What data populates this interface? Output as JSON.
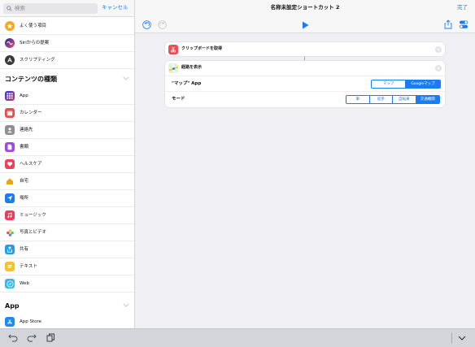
{
  "sidebar": {
    "search_placeholder": "検索",
    "cancel_label": "キャンセル",
    "top_items": [
      {
        "label": "よく使う項目",
        "icon": "star-icon",
        "color": "#f5a623"
      },
      {
        "label": "Siriからの提案",
        "icon": "siri-icon",
        "color": "#5b5fd6"
      },
      {
        "label": "スクリプティング",
        "icon": "scripting-icon",
        "color": "#3a3a3c"
      }
    ],
    "content_section_title": "コンテンツの種類",
    "content_items": [
      {
        "label": "App",
        "icon": "app-grid-icon",
        "color": "#5a3fd1"
      },
      {
        "label": "カレンダー",
        "icon": "calendar-icon",
        "color": "#ec4b4b"
      },
      {
        "label": "連絡先",
        "icon": "contacts-icon",
        "color": "#8e8e93"
      },
      {
        "label": "書類",
        "icon": "document-icon",
        "color": "#a347e0"
      },
      {
        "label": "ヘルスケア",
        "icon": "heart-icon",
        "color": "#ef3f5a"
      },
      {
        "label": "自宅",
        "icon": "home-icon",
        "color": "#f0a21a"
      },
      {
        "label": "場所",
        "icon": "location-icon",
        "color": "#1a7cf3"
      },
      {
        "label": "ミュージック",
        "icon": "music-icon",
        "color": "#f03b5c"
      },
      {
        "label": "写真とビデオ",
        "icon": "photos-icon",
        "color": "#f5c542"
      },
      {
        "label": "共有",
        "icon": "share-icon",
        "color": "#1fa0ea"
      },
      {
        "label": "テキスト",
        "icon": "text-icon",
        "color": "#f6c429"
      },
      {
        "label": "Web",
        "icon": "safari-icon",
        "color": "#37b7f0"
      }
    ],
    "app_section_title": "App",
    "app_items": [
      {
        "label": "App Store",
        "icon": "app-store-icon",
        "color": "#1a8cf6"
      }
    ]
  },
  "header": {
    "title": "名称未設定ショートカット 2",
    "done_label": "完了"
  },
  "actions": {
    "clipboard": {
      "title": "クリップボードを取得",
      "color": "#ef4b57",
      "icon": "scissors-icon"
    },
    "directions": {
      "title": "経路を表示",
      "icon": "maps-icon",
      "app_param": {
        "label": "\"マップ\" App",
        "options": [
          "マップ",
          "Googleマップ"
        ],
        "selected": "Googleマップ"
      },
      "mode_param": {
        "label": "モード",
        "options": [
          "車",
          "徒歩",
          "自転車",
          "交通機関"
        ],
        "selected": "交通機関"
      }
    }
  },
  "colors": {
    "accent": "#1a7cf3"
  }
}
